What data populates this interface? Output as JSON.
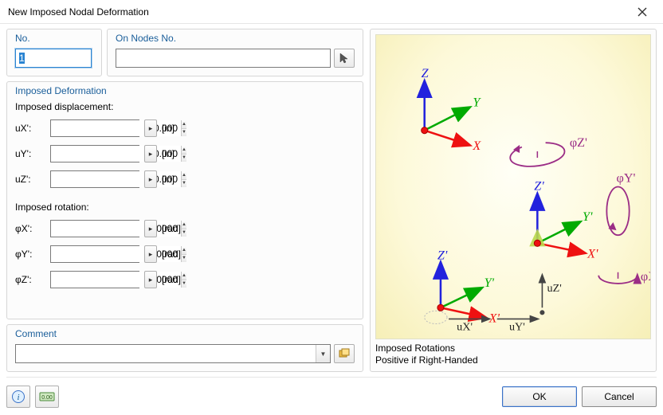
{
  "window": {
    "title": "New Imposed Nodal Deformation"
  },
  "groups": {
    "no_label": "No.",
    "nodes_label": "On Nodes No.",
    "imposed_def_label": "Imposed Deformation",
    "comment_label": "Comment"
  },
  "no_value": "1",
  "nodes_value": "",
  "sections": {
    "displacement_label": "Imposed displacement:",
    "rotation_label": "Imposed rotation:"
  },
  "disp": {
    "ux": {
      "label": "uX':",
      "value": "0.000",
      "unit": "[in]"
    },
    "uy": {
      "label": "uY':",
      "value": "0.000",
      "unit": "[in]"
    },
    "uz": {
      "label": "uZ':",
      "value": "0.000",
      "unit": "[in]"
    }
  },
  "rot": {
    "phx": {
      "label": "φX':",
      "value": "0.0000",
      "unit": "[rad]"
    },
    "phy": {
      "label": "φY':",
      "value": "0.0000",
      "unit": "[rad]"
    },
    "phz": {
      "label": "φZ':",
      "value": "0.0000",
      "unit": "[rad]"
    }
  },
  "comment_value": "",
  "preview": {
    "caption_line1": "Imposed Rotations",
    "caption_line2": "Positive if Right-Handed",
    "axes": {
      "X": "X",
      "Y": "Y",
      "Z": "Z",
      "Xp": "X'",
      "Yp": "Y'",
      "Zp": "Z'",
      "uXp": "uX'",
      "uYp": "uY'",
      "uZp": "uZ'",
      "phiXp": "φX'",
      "phiYp": "φY'",
      "phiZp": "φZ'"
    }
  },
  "buttons": {
    "ok": "OK",
    "cancel": "Cancel"
  }
}
